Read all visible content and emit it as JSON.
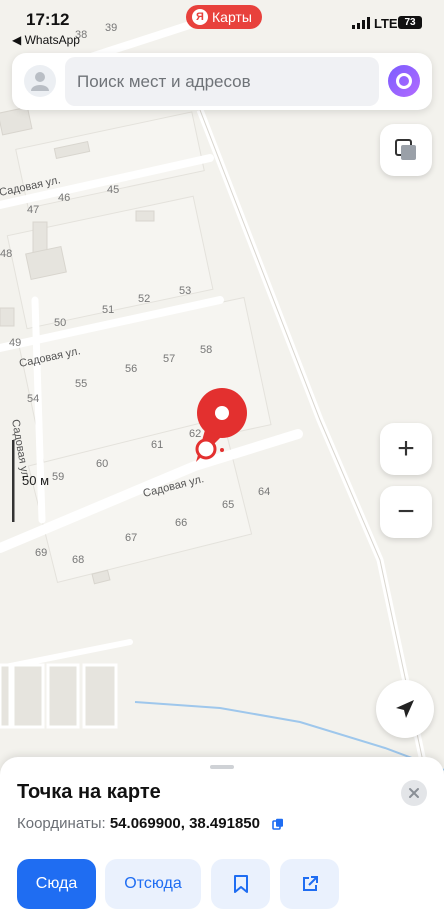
{
  "status": {
    "time": "17:12",
    "back_label": "◀ WhatsApp",
    "network": "LTE",
    "battery": "73"
  },
  "brand": {
    "logo": "Я",
    "name": "Карты",
    "color": "#e8413c"
  },
  "search": {
    "placeholder": "Поиск мест и адресов"
  },
  "map": {
    "streets": [
      "Садовая ул.",
      "Садовая ул.",
      "Садовая ул.",
      "Садовая ул."
    ],
    "houses": [
      "39",
      "38",
      "45",
      "47",
      "46",
      "48",
      "51",
      "52",
      "53",
      "50",
      "49",
      "56",
      "57",
      "58",
      "55",
      "54",
      "61",
      "62",
      "60",
      "59",
      "65",
      "64",
      "66",
      "67",
      "69",
      "68"
    ],
    "scale": "50 м",
    "pin_color": "#e3302f"
  },
  "controls": {
    "zoom_in": "+",
    "zoom_out": "−"
  },
  "sheet": {
    "title": "Точка на карте",
    "coords_label": "Координаты:",
    "coords_value": "54.069900, 38.491850",
    "btn_here": "Сюда",
    "btn_from": "Отсюда"
  },
  "colors": {
    "accent": "#1f6df2",
    "button_secondary_bg": "#eaf1fd",
    "map_bg": "#f3f2ed",
    "road": "#ffffff"
  }
}
